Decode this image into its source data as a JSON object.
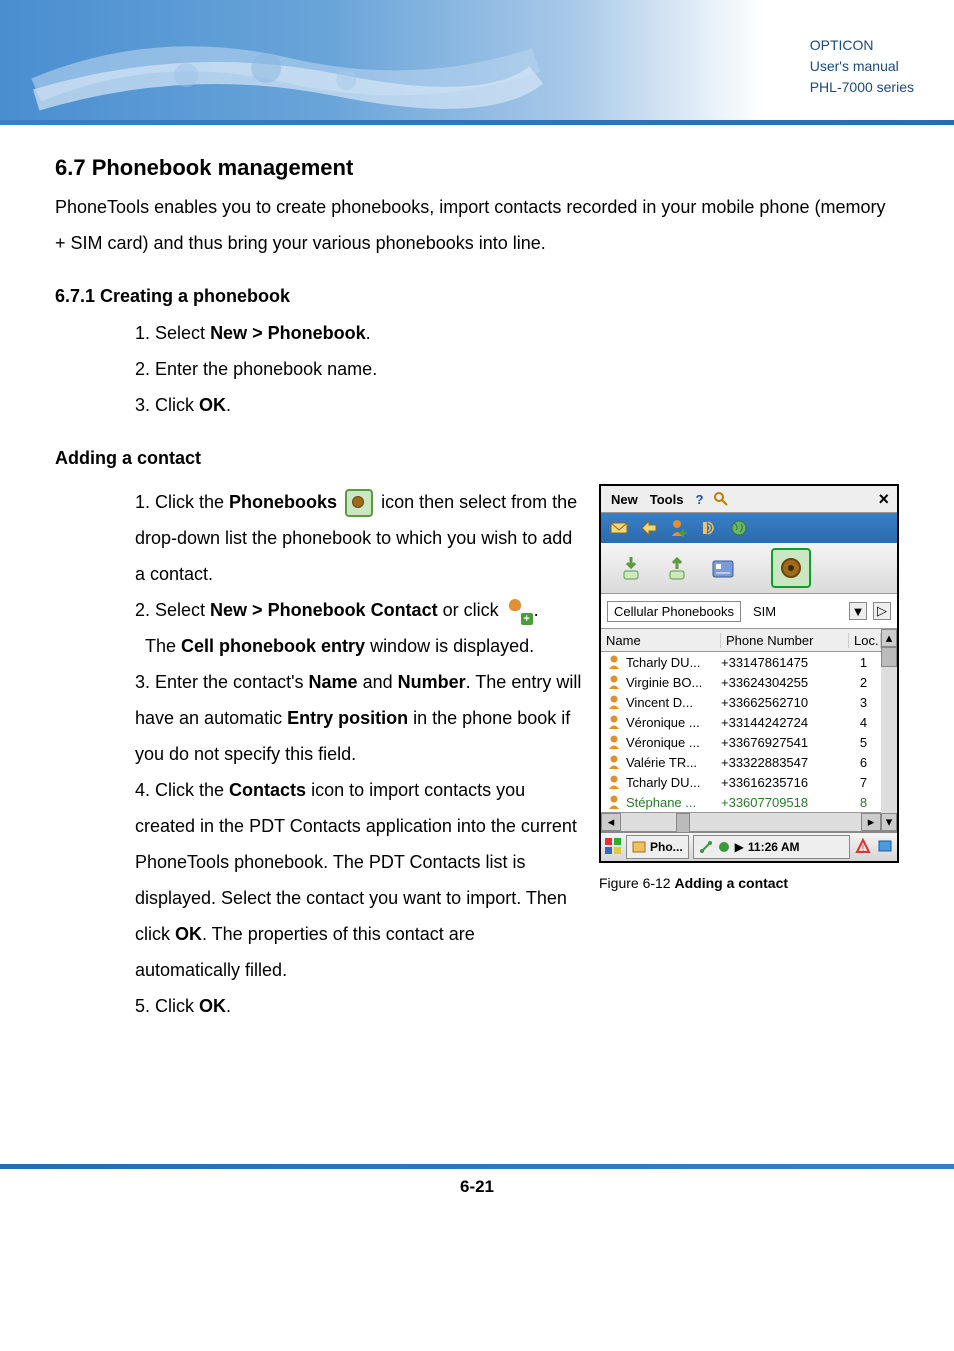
{
  "header_meta": {
    "brand": "OPTICON",
    "line2": "User's manual",
    "line3": "PHL-7000 series"
  },
  "section": {
    "title": "6.7 Phonebook management",
    "intro": "PhoneTools enables you to create phonebooks, import contacts recorded in your mobile phone (memory + SIM card) and thus bring your various phonebooks into line."
  },
  "subsection1": {
    "title": "6.7.1 Creating a phonebook",
    "steps": [
      {
        "n": "1.",
        "pre": "Select ",
        "b": "New > Phonebook",
        "post": "."
      },
      {
        "n": "2.",
        "pre": "Enter the phonebook name.",
        "b": "",
        "post": ""
      },
      {
        "n": "3.",
        "pre": "Click ",
        "b": "OK",
        "post": "."
      }
    ]
  },
  "adding": {
    "heading": "Adding a contact",
    "step1_a": "1. Click the ",
    "step1_b": "Phonebooks",
    "step1_c": " icon then select from the drop-down list the phonebook to which you wish to add a contact.",
    "step2_a": "2. Select ",
    "step2_b": "New > Phonebook Contact",
    "step2_c": " or click ",
    "step2_d": ".",
    "step2_caption_a": "The ",
    "step2_caption_b": "Cell phonebook entry",
    "step2_caption_c": " window is displayed.",
    "step3_a": "3. Enter the contact's ",
    "step3_b": "Name",
    "step3_c": " and ",
    "step3_d": "Number",
    "step3_e": ". The entry will have an automatic ",
    "step3_f": "Entry position",
    "step3_g": " in the phone book if you do not specify this field.",
    "step4_a": "4. Click the ",
    "step4_b": "Contacts",
    "step4_c": " icon to import contacts you created in the PDT Contacts application into the current PhoneTools phonebook. The PDT Contacts list is displayed. Select the contact you want to import. Then click ",
    "step4_d": "OK",
    "step4_e": ". The properties of this contact are automatically filled.",
    "step5_a": "5. Click ",
    "step5_b": "OK",
    "step5_c": "."
  },
  "screenshot": {
    "menu": {
      "new": "New",
      "tools": "Tools",
      "help": "?",
      "close": "×"
    },
    "dropdown": {
      "selected": "Cellular Phonebooks",
      "next": "SIM"
    },
    "columns": {
      "name": "Name",
      "phone": "Phone Number",
      "loc": "Loc."
    },
    "rows": [
      {
        "name": "Tcharly DU...",
        "phone": "+33147861475",
        "loc": "1"
      },
      {
        "name": "Virginie BO...",
        "phone": "+33624304255",
        "loc": "2"
      },
      {
        "name": "Vincent D...",
        "phone": "+33662562710",
        "loc": "3"
      },
      {
        "name": "Véronique ...",
        "phone": "+33144242724",
        "loc": "4"
      },
      {
        "name": "Véronique ...",
        "phone": "+33676927541",
        "loc": "5"
      },
      {
        "name": "Valérie TR...",
        "phone": "+33322883547",
        "loc": "6"
      },
      {
        "name": "Tcharly DU...",
        "phone": "+33616235716",
        "loc": "7"
      },
      {
        "name": "Stéphane ...",
        "phone": "+33607709518",
        "loc": "8"
      }
    ],
    "taskbar": {
      "app": "Pho...",
      "time": "11:26 AM"
    }
  },
  "figure": {
    "num": "Figure 6-12 ",
    "title": "Adding a contact"
  },
  "page_number": "6-21"
}
